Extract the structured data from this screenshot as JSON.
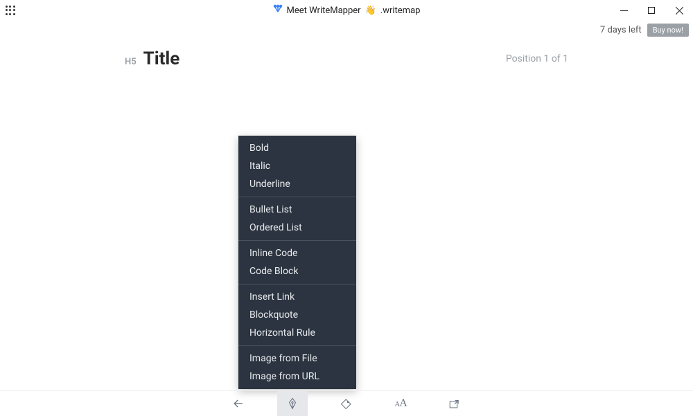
{
  "window": {
    "app_name": "Meet WriteMapper",
    "file_icon": "👋",
    "file_ext": ".writemap"
  },
  "trial": {
    "days_left": "7 days left",
    "buy_label": "Buy now!"
  },
  "document": {
    "heading_level": "H5",
    "title": "Title",
    "position": "Position 1 of 1"
  },
  "context_menu": {
    "groups": [
      {
        "items": [
          "Bold",
          "Italic",
          "Underline"
        ]
      },
      {
        "items": [
          "Bullet List",
          "Ordered List"
        ]
      },
      {
        "items": [
          "Inline Code",
          "Code Block"
        ]
      },
      {
        "items": [
          "Insert Link",
          "Blockquote",
          "Horizontal Rule"
        ]
      },
      {
        "items": [
          "Image from File",
          "Image from URL"
        ]
      }
    ]
  },
  "toolbar": {
    "back": "back",
    "pen": "pen",
    "tag": "tag",
    "text_style": "text-style",
    "share": "share"
  }
}
